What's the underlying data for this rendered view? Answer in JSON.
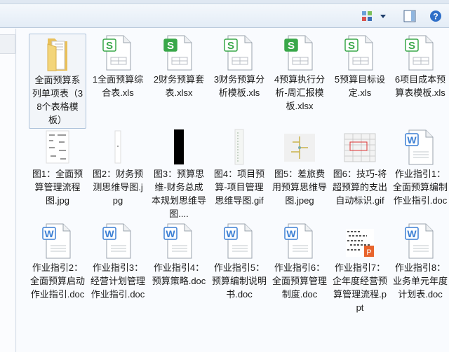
{
  "toolbar": {
    "view_icon": "change-view-icon",
    "view_dropdown": "chevron-down-icon",
    "preview_pane": "preview-pane-icon",
    "help": "help-icon"
  },
  "colors": {
    "xls_green": "#3aa84a",
    "doc_blue": "#3b7fd4",
    "ppt_orange": "#e8642c",
    "folder": "#f3d57a"
  },
  "items": [
    {
      "label": "全面预算系列单项表（38个表格模板）",
      "type": "folder",
      "selected": true
    },
    {
      "label": "1全面预算综合表.xls",
      "type": "xls"
    },
    {
      "label": "2财务预算套表.xlsx",
      "type": "xlsx"
    },
    {
      "label": "3财务预算分析模板.xls",
      "type": "xls"
    },
    {
      "label": "4预算执行分析-周汇报模板.xlsx",
      "type": "xlsx"
    },
    {
      "label": "5预算目标设定.xls",
      "type": "xls"
    },
    {
      "label": "6项目成本预算表模板.xls",
      "type": "xls"
    },
    {
      "label": "图1：全面预算管理流程图.jpg",
      "type": "img",
      "thumb": "flow"
    },
    {
      "label": "图2：财务预测思维导图.jpg",
      "type": "img",
      "thumb": "thin"
    },
    {
      "label": "图3：预算思维-财务总成本规划思维导图....",
      "type": "img",
      "thumb": "black"
    },
    {
      "label": "图4：项目预算-项目管理思维导图.gif",
      "type": "img",
      "thumb": "tall"
    },
    {
      "label": "图5：差旅费用预算思维导图.jpeg",
      "type": "img",
      "thumb": "mind"
    },
    {
      "label": "图6：技巧-将超预算的支出自动标识.gif",
      "type": "img",
      "thumb": "sheet"
    },
    {
      "label": "作业指引1：全面预算编制作业指引.doc",
      "type": "doc"
    },
    {
      "label": "作业指引2：全面预算启动作业指引.doc",
      "type": "doc"
    },
    {
      "label": "作业指引3：经营计划管理作业指引.doc",
      "type": "doc"
    },
    {
      "label": "作业指引4：预算策略.doc",
      "type": "doc"
    },
    {
      "label": "作业指引5：预算编制说明书.doc",
      "type": "doc"
    },
    {
      "label": "作业指引6：全面预算管理制度.doc",
      "type": "doc"
    },
    {
      "label": "作业指引7：企年度经营预算管理流程.ppt",
      "type": "ppt"
    },
    {
      "label": "作业指引8：业务单元年度计划表.doc",
      "type": "doc"
    }
  ]
}
